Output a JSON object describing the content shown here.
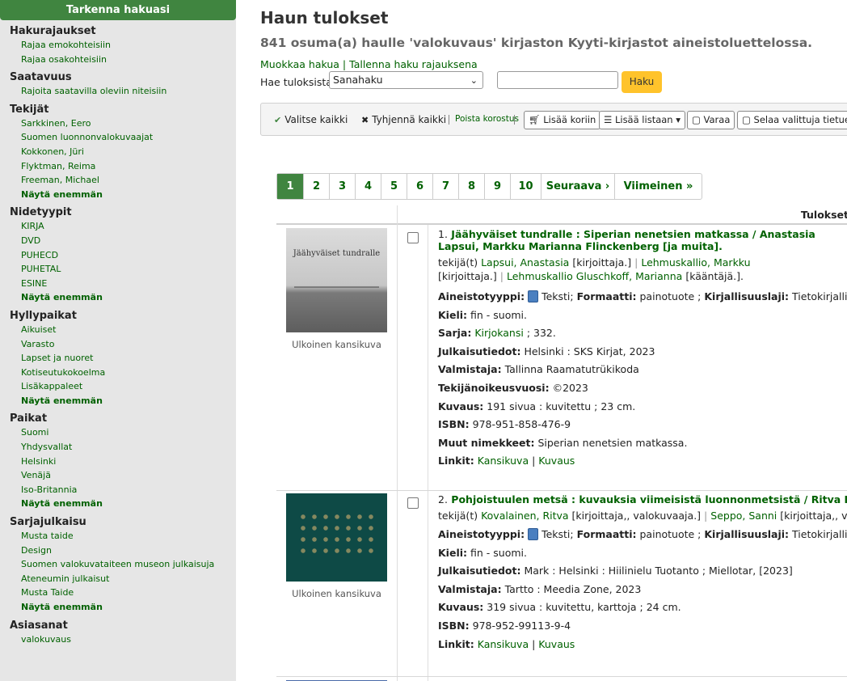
{
  "sidebar": {
    "title": "Tarkenna hakuasi",
    "facets": [
      {
        "heading": "Hakurajaukset",
        "items": [
          "Rajaa emokohteisiin",
          "Rajaa osakohteisiin"
        ]
      },
      {
        "heading": "Saatavuus",
        "items": [
          "Rajoita saatavilla oleviin niteisiin"
        ]
      },
      {
        "heading": "Tekijät",
        "items": [
          "Sarkkinen, Eero",
          "Suomen luonnonvalokuvaajat",
          "Kokkonen, Jüri",
          "Flyktman, Reima",
          "Freeman, Michael"
        ],
        "more": "Näytä enemmän"
      },
      {
        "heading": "Nidetyypit",
        "items": [
          "KIRJA",
          "DVD",
          "PUHECD",
          "PUHETAL",
          "ESINE"
        ],
        "more": "Näytä enemmän"
      },
      {
        "heading": "Hyllypaikat",
        "items": [
          "Aikuiset",
          "Varasto",
          "Lapset ja nuoret",
          "Kotiseutukokoelma",
          "Lisäkappaleet"
        ],
        "more": "Näytä enemmän"
      },
      {
        "heading": "Paikat",
        "items": [
          "Suomi",
          "Yhdysvallat",
          "Helsinki",
          "Venäjä",
          "Iso-Britannia"
        ],
        "more": "Näytä enemmän"
      },
      {
        "heading": "Sarjajulkaisu",
        "items": [
          "Musta taide",
          "Design",
          "Suomen valokuvataiteen museon julkaisuja",
          "Ateneumin julkaisut",
          "Musta Taide"
        ],
        "more": "Näytä enemmän"
      },
      {
        "heading": "Asiasanat",
        "items": [
          "valokuvaus"
        ]
      }
    ]
  },
  "main": {
    "title": "Haun tulokset",
    "summary": "841 osuma(a) haulle 'valokuvaus' kirjaston Kyyti-kirjastot aineistoluettelossa.",
    "links": {
      "edit": "Muokkaa hakua",
      "sep": "|",
      "save": "Tallenna haku rajauksena"
    },
    "search": {
      "label": "Hae tuloksista",
      "select": "Sanahaku",
      "button": "Haku",
      "input": ""
    }
  },
  "toolbar": {
    "select_all": "Valitse kaikki",
    "clear_all": "Tyhjennä kaikki",
    "highlight": "Poista korostus",
    "cart": "Lisää koriin",
    "list": "Lisää listaan",
    "hold": "Varaa",
    "browse": "Selaa valittuja tietueita"
  },
  "pagination": {
    "pages": [
      "1",
      "2",
      "3",
      "4",
      "5",
      "6",
      "7",
      "8",
      "9",
      "10"
    ],
    "next": "Seuraava ›",
    "last": "Viimeinen »",
    "current": "1"
  },
  "results": {
    "header": "Tulokset",
    "items": [
      {
        "number": "1.",
        "title": "Jäähyväiset tundralle : Siperian nenetsien matkassa / Anastasia Lapsui, Markku Marianna Flinckenberg [ja muita].",
        "cover_caption": "Ulkoinen kansikuva",
        "cover_text": "Jäähyväiset tundralle",
        "authors_prefix": "tekijä(t)",
        "authors": [
          {
            "name": "Lapsui, Anastasia",
            "role": "[kirjoittaja.]"
          },
          {
            "name": "Lehmuskallio, Markku",
            "role": "[kirjoittaja.]"
          },
          {
            "name": "Lehmuskallio",
            "role": ""
          },
          {
            "name": "Gluschkoff, Marianna",
            "role": "[kääntäjä.]."
          }
        ],
        "type_label": "Aineistotyyppi:",
        "type_value": "Teksti;",
        "format_label": "Formaatti:",
        "format_value": "painotuote ;",
        "genre_label": "Kirjallisuuslaji:",
        "genre_value": "Tietokirjallisuus",
        "language_label": "Kieli:",
        "language_value": "fin - suomi.",
        "series_label": "Sarja:",
        "series_link": "Kirjokansi",
        "series_rest": "; 332.",
        "pub_label": "Julkaisutiedot:",
        "pub_value": "Helsinki : SKS Kirjat, 2023",
        "maker_label": "Valmistaja:",
        "maker_value": "Tallinna Raamatutrükikoda",
        "copyright_label": "Tekijänoikeusvuosi:",
        "copyright_value": "©2023",
        "desc_label": "Kuvaus:",
        "desc_value": "191 sivua : kuvitettu ; 23 cm.",
        "isbn_label": "ISBN:",
        "isbn_value": "978-951-858-476-9",
        "other_label": "Muut nimekkeet:",
        "other_value": "Siperian nenetsien matkassa.",
        "links_label": "Linkit:",
        "link1": "Kansikuva",
        "link_sep": "|",
        "link2": "Kuvaus"
      },
      {
        "number": "2.",
        "title": "Pohjoistuulen metsä : kuvauksia viimeisistä luonnonmetsistä / Ritva Kovalainen",
        "cover_caption": "Ulkoinen kansikuva",
        "authors_prefix": "tekijä(t)",
        "authors": [
          {
            "name": "Kovalainen, Ritva",
            "role": "[kirjoittaja,, valokuvaaja.]"
          },
          {
            "name": "Seppo, Sanni",
            "role": "[kirjoittaja,, valokuvaa"
          }
        ],
        "type_label": "Aineistotyyppi:",
        "type_value": "Teksti;",
        "format_label": "Formaatti:",
        "format_value": "painotuote ;",
        "genre_label": "Kirjallisuuslaji:",
        "genre_value": "Tietokirjallisuus",
        "language_label": "Kieli:",
        "language_value": "fin - suomi.",
        "pub_label": "Julkaisutiedot:",
        "pub_value": "Mark : Helsinki : Hiilinielu Tuotanto ; Miellotar, [2023]",
        "maker_label": "Valmistaja:",
        "maker_value": "Tartto : Meedia Zone, 2023",
        "desc_label": "Kuvaus:",
        "desc_value": "319 sivua : kuvitettu, karttoja ; 24 cm.",
        "isbn_label": "ISBN:",
        "isbn_value": "978-952-99113-9-4",
        "links_label": "Linkit:",
        "link1": "Kansikuva",
        "link_sep": "|",
        "link2": "Kuvaus"
      }
    ]
  },
  "colors": {
    "accent": "#408540",
    "link": "#006100",
    "button": "#ffc32b",
    "sidebar_bg": "#e6e6e6"
  }
}
